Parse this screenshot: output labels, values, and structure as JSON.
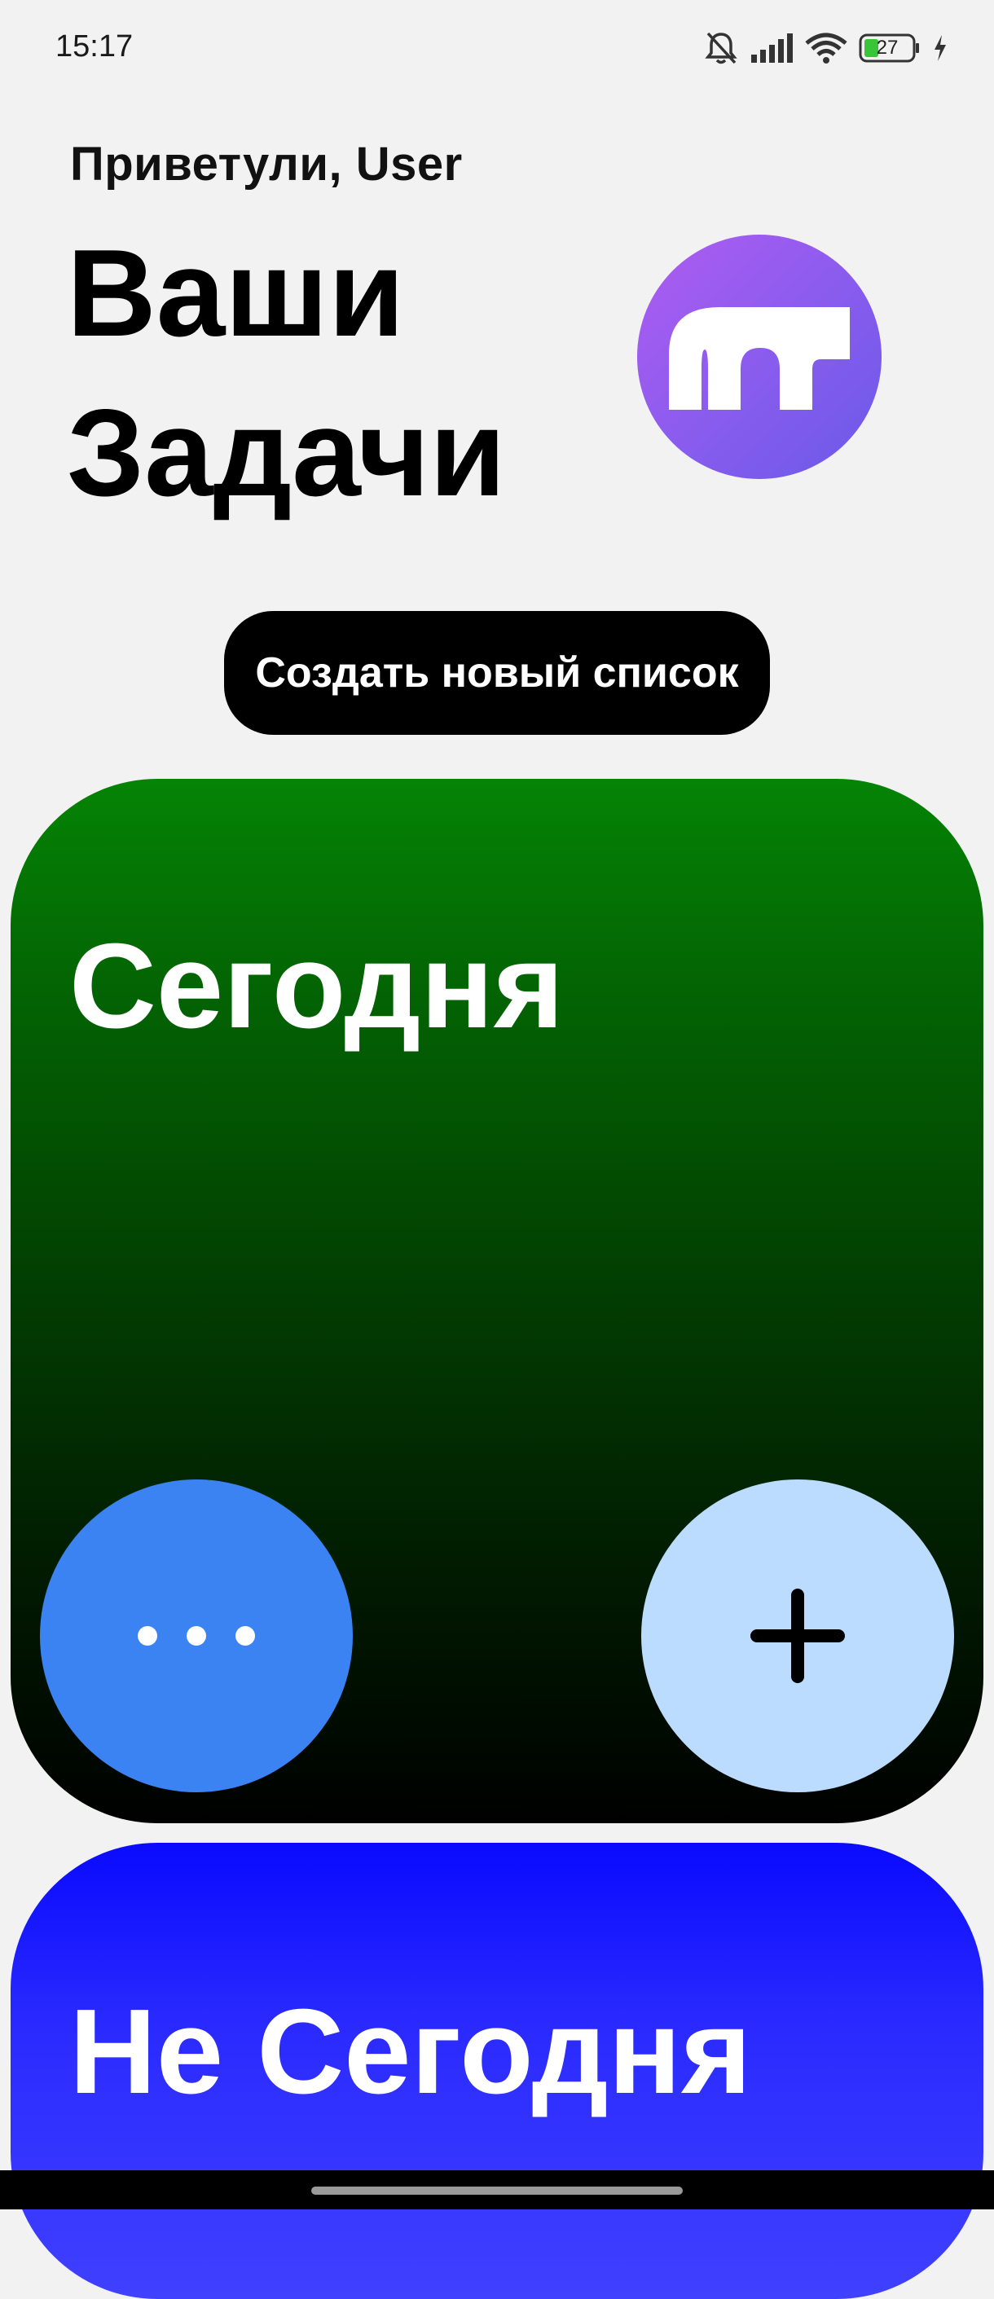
{
  "status_bar": {
    "time": "15:17",
    "battery": "27",
    "icons": [
      "bell-muted-icon",
      "signal-icon",
      "wifi-icon",
      "battery-icon",
      "charging-icon"
    ]
  },
  "header": {
    "greeting": "Приветули, User",
    "title_line1": "Ваши",
    "title_line2": "Задачи",
    "logo_icon": "app-logo-icon"
  },
  "create_button": {
    "label": "Создать новый список"
  },
  "lists": [
    {
      "title": "Сегодня",
      "color_top": "#058405",
      "color_bottom": "#000000",
      "more_icon": "more-dots-icon",
      "add_icon": "plus-icon"
    },
    {
      "title": "Не Сегодня",
      "color_top": "#0a0aff",
      "color_bottom": "#4040ff"
    }
  ],
  "colors": {
    "more_button": "#3b82f2",
    "add_button": "#bcdcff",
    "background": "#f2f2f2"
  }
}
